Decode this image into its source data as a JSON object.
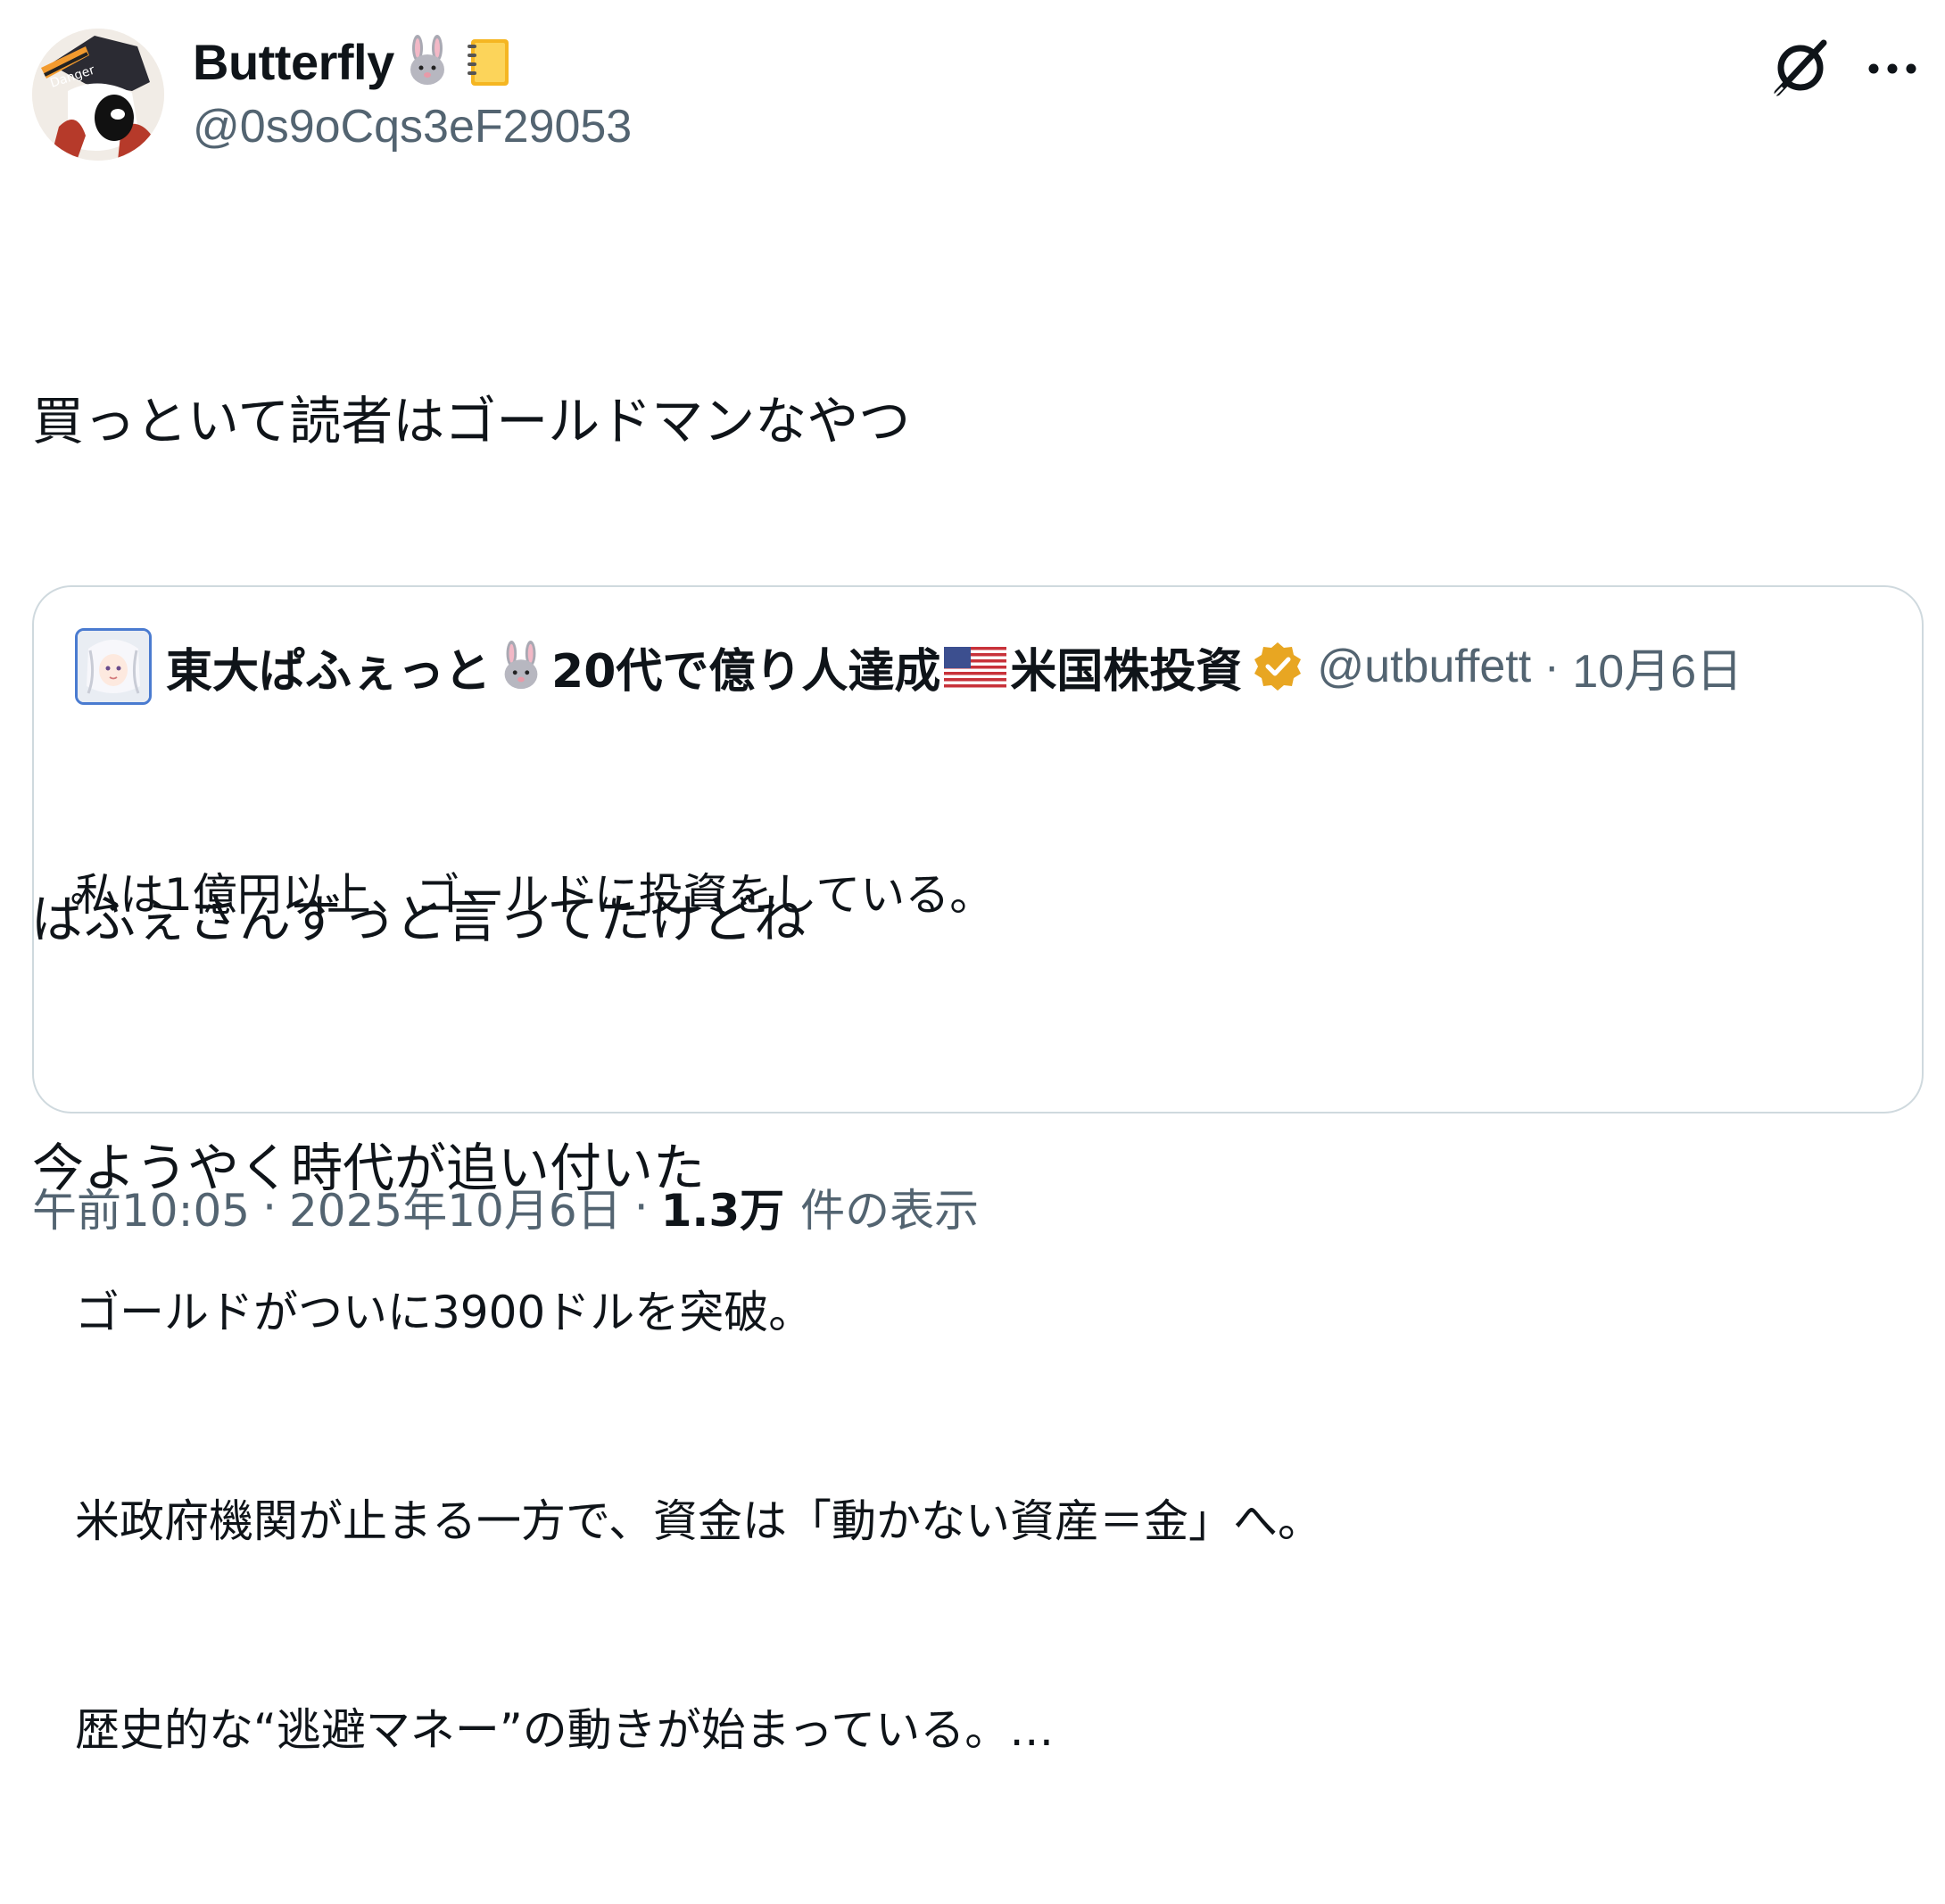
{
  "author": {
    "display_name": "Butterfly",
    "emojis": [
      "rabbit-face",
      "notebook"
    ],
    "handle": "@0s9oCqs3eF29053"
  },
  "header_icons": [
    "grok-icon",
    "more-icon"
  ],
  "tweet": {
    "lines": [
      "買っといて読者はゴールドマンなやつ",
      "",
      "ぱふぇさんずっと言ってたけどね",
      "今ようやく時代が追い付いた"
    ]
  },
  "quote": {
    "name_part1": "東大ぱふぇっと",
    "name_part2": "20代で億り人達成",
    "name_part3": "米国株投資",
    "name_emojis": [
      "rabbit-face",
      "us-flag"
    ],
    "verified": true,
    "handle": "@utbuffett",
    "date": "10月6日",
    "meta_sep": " · ",
    "lines": [
      "私は1億円以上、ゴールドに投資をしている。",
      "",
      "ゴールドがついに3900ドルを突破。",
      "米政府機関が止まる一方で、資金は「動かない資産＝金」へ。",
      "歴史的な“逃避マネー”の動きが始まっている。…"
    ]
  },
  "footer": {
    "time": "午前10:05",
    "sep": "·",
    "date": "2025年10月6日",
    "views": "1.3万",
    "views_label": "件の表示"
  },
  "colors": {
    "text": "#0f1419",
    "secondary": "#536471",
    "border": "#cfd9de",
    "verified_gold": "#e8a622"
  }
}
